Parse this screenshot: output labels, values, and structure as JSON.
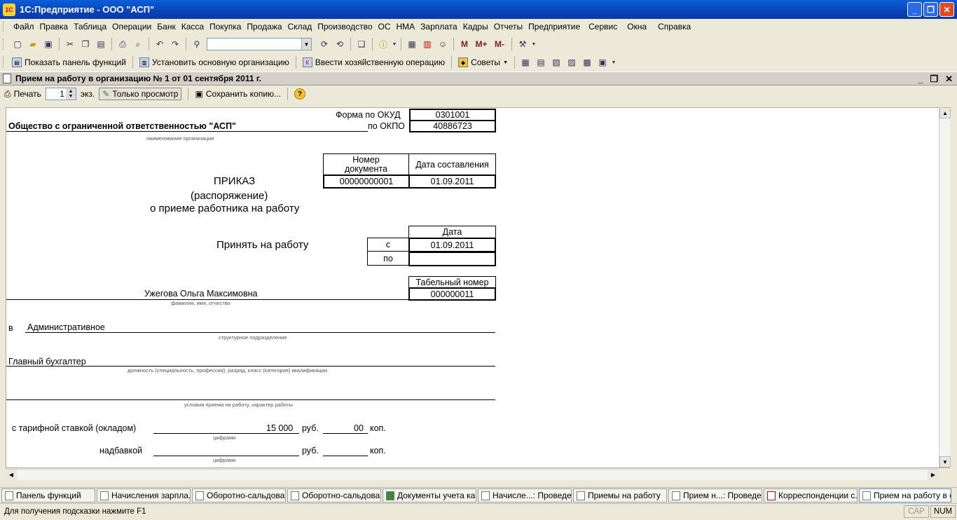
{
  "window": {
    "title": "1С:Предприятие - ООО \"АСП\"",
    "app_icon": "1С"
  },
  "menu": [
    "Файл",
    "Правка",
    "Таблица",
    "Операции",
    "Банк",
    "Касса",
    "Покупка",
    "Продажа",
    "Склад",
    "Производство",
    "ОС",
    "НМА",
    "Зарплата",
    "Кадры",
    "Отчеты",
    "Предприятие",
    "Сервис",
    "Окна",
    "Справка"
  ],
  "toolbar2": {
    "show_panel": "Показать панель функций",
    "set_org": "Установить основную организацию",
    "enter_op": "Ввести хозяйственную операцию",
    "tips": "Советы"
  },
  "toolbar1": {
    "m": "M",
    "mplus": "M+",
    "mminus": "M-"
  },
  "document": {
    "title": "Прием на работу в организацию  № 1 от 01 сентября 2011 г.",
    "print_label": "Печать",
    "copies_value": "1",
    "copies_unit": "экз.",
    "view_only": "Только просмотр",
    "save_copy": "Сохранить копию..."
  },
  "form": {
    "okud_label": "Форма по ОКУД",
    "okud": "0301001",
    "org_name": "Общество с ограниченной ответственностью \"АСП\"",
    "okpo_label": "по ОКПО",
    "okpo": "40886723",
    "org_caption": "наименование организации",
    "doc_number_header": "Номер документа",
    "doc_date_header": "Дата составления",
    "doc_number": "00000000001",
    "doc_date": "01.09.2011",
    "title1": "ПРИКАЗ",
    "title2": "(распоряжение)",
    "title3": "о приеме работника на работу",
    "hire_label": "Принять на работу",
    "date_header": "Дата",
    "from_label": "с",
    "from_date": "01.09.2011",
    "to_label": "по",
    "to_date": "",
    "tab_header": "Табельный номер",
    "employee": "Ужегова Ольга Максимовна",
    "tab_number": "000000011",
    "fio_caption": "фамилия, имя, отчество",
    "dept_prefix": "в",
    "dept": "Административное",
    "dept_caption": "структурное подразделение",
    "position": "Главный бухгалтер",
    "position_caption": "должность (специальность, профессия), разряд, класс (категория) квалификации",
    "conditions_caption": "условия приема на работу, характер работы",
    "rate_label": "с тарифной ставкой (окладом)",
    "rate_rub": "15 000",
    "rub_label": "руб.",
    "rate_kop": "00",
    "kop_label": "коп.",
    "digits_caption": "цифрами",
    "bonus_label": "надбавкой",
    "bonus_rub_label": "руб.",
    "bonus_kop_label": "коп.",
    "digits_caption2": "цифрами"
  },
  "taskbar": [
    "Панель функций",
    "Начисления зарпла...",
    "Оборотно-сальдова...",
    "Оборотно-сальдова...",
    "Документы учета ка...",
    "Начисле...: Проведен",
    "Приемы на работу",
    "Прием н...: Проведен",
    "Корреспонденции с...",
    "Прием на работу в о..."
  ],
  "status": {
    "hint": "Для получения подсказки нажмите F1",
    "cap": "CAP",
    "num": "NUM"
  },
  "colors": {
    "titlebar": "#0842b8",
    "close": "#e04a1e",
    "workspace": "#ece9d8"
  }
}
